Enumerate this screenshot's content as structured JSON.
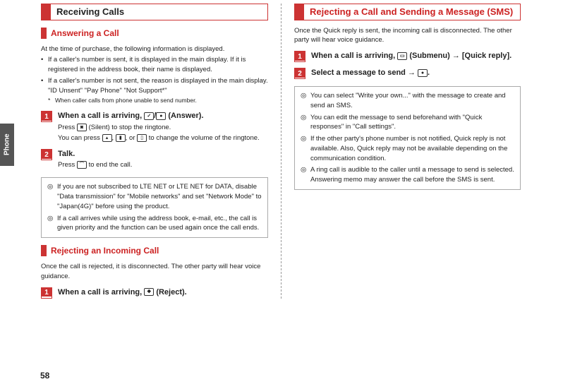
{
  "sideTab": "Phone",
  "pageNumber": "58",
  "left": {
    "h1": "Receiving Calls",
    "answering": {
      "h2": "Answering a Call",
      "intro": "At the time of purchase, the following information is displayed.",
      "bullets": [
        "If a caller's number is sent, it is displayed in the main display. If it is registered in the address book, their name is displayed.",
        "If a caller's number is not sent, the reason is displayed in the main display."
      ],
      "examples": "\"ID Unsent\" \"Pay Phone\" \"Not Support*\"",
      "footnote": "When caller calls from phone unable to send number.",
      "step1": {
        "title_pre": "When a call is arriving, ",
        "title_post": " (Answer).",
        "sub1_pre": "Press ",
        "sub1_post": " (Silent) to stop the ringtone.",
        "sub2_pre": "You can press ",
        "sub2_mid1": ", ",
        "sub2_mid2": ", or ",
        "sub2_post": " to change the volume of the ringtone."
      },
      "step2": {
        "title": "Talk.",
        "sub_pre": "Press ",
        "sub_post": " to end the call."
      },
      "info": [
        "If you are not subscribed to LTE NET or LTE NET for DATA, disable \"Data transmission\" for \"Mobile networks\" and set \"Network Mode\" to \"Japan(4G)\" before using the product.",
        "If a call arrives while using the address book, e-mail, etc., the call is given priority and the function can be used again once the call ends."
      ]
    },
    "rejecting": {
      "h2": "Rejecting an Incoming Call",
      "intro": "Once the call is rejected, it is disconnected. The other party will hear voice guidance.",
      "step1": {
        "title_pre": "When a call is arriving, ",
        "title_post": " (Reject)."
      }
    }
  },
  "right": {
    "h1": "Rejecting a Call and Sending a Message (SMS)",
    "intro": "Once the Quick reply is sent, the incoming call is disconnected. The other party will hear voice guidance.",
    "step1": {
      "title_pre": "When a call is arriving, ",
      "title_mid": " (Submenu) ",
      "title_post": " [Quick reply]."
    },
    "step2": {
      "title_pre": "Select a message to send ",
      "title_post": "."
    },
    "info": [
      "You can select \"Write your own...\" with the message to create and send an SMS.",
      "You can edit the message to send beforehand with \"Quick responses\" in \"Call settings\".",
      "If the other party's phone number is not notified, Quick reply is not available. Also, Quick reply may not be available depending on the communication condition.",
      "A ring call is audible to the caller until a message to send is selected. Answering memo may answer the call before the SMS is sent."
    ]
  },
  "keys": {
    "call": "✓",
    "center": "●",
    "camera": "◙",
    "end": "⌒",
    "up": "▴",
    "side": "▮",
    "sideB": "▯",
    "app": "❖",
    "submenu": "▭"
  }
}
